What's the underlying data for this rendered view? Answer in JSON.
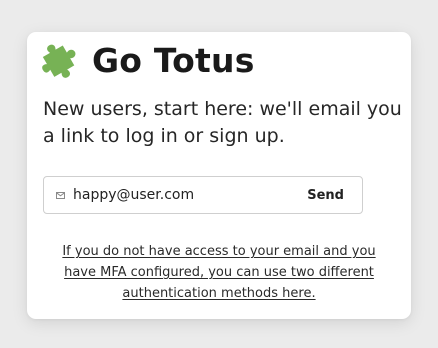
{
  "brand": {
    "title": "Go Totus",
    "icon": "puzzle-piece-icon"
  },
  "intro": {
    "text": "New users, start here: we'll email you a link to log in or sign up."
  },
  "form": {
    "email_value": "happy@user.com",
    "send_label": "Send",
    "icon": "mail-icon"
  },
  "mfa": {
    "link_text": "If you do not have access to your email and you have MFA configured, you can use two different authentication methods here."
  },
  "colors": {
    "puzzle": "#77b255",
    "card_background": "#ffffff",
    "page_background": "#ebebeb"
  }
}
